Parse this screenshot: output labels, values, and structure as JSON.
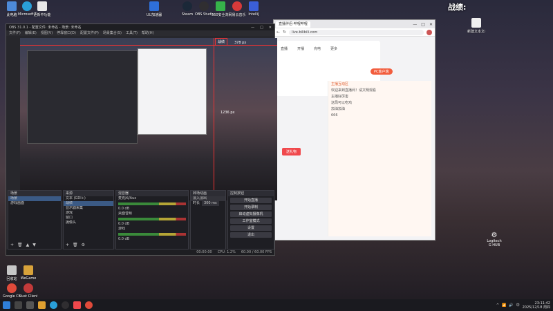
{
  "desktop": {
    "top_icons": [
      {
        "label": "此电脑"
      },
      {
        "label": "Microsoft Edge"
      },
      {
        "label": "更新中功能"
      },
      {
        "label": "UU加速器"
      },
      {
        "label": "Steam"
      },
      {
        "label": "OBS Studio"
      },
      {
        "label": "360安全浏览器"
      },
      {
        "label": "网易云音乐"
      },
      {
        "label": "IntelliJ"
      }
    ],
    "left_icons": [
      {
        "label": "回收站"
      },
      {
        "label": "Google Chrome"
      },
      {
        "label": "WeGame"
      },
      {
        "label": "Rust Client"
      }
    ],
    "right_icon_label": "新建文本文档",
    "corner_text": "战绩:",
    "logitech_label": "Logitech G HUB"
  },
  "browser": {
    "tab_title": "直播伴侣-哔哩哔哩",
    "url": "live.bilibili.com",
    "pc_badge": "PC客户端",
    "nav_items": [
      "直播",
      "开播",
      "充电",
      "更多"
    ],
    "chat_header": "主播互动区",
    "chat_messages": [
      "欢迎来到直播间！请文明观看",
      "主播好厉害",
      "这局可以吃鸡",
      "加油加油",
      "666"
    ],
    "gift_button": "送礼物"
  },
  "obs": {
    "title": "OBS 31.0.1 - 配置文件: 未命名 - 场景: 未命名",
    "menu": [
      "文件(F)",
      "编辑(E)",
      "视图(V)",
      "停靠窗口(D)",
      "配置文件(P)",
      "场景集合(S)",
      "工具(T)",
      "帮助(H)"
    ],
    "preview_dimension_label": "1236 px",
    "preview_top_label": "战绩",
    "preview_width_label": "378 px",
    "panels": {
      "scenes": {
        "title": "场景",
        "items": [
          "场景",
          "游戏画面"
        ]
      },
      "sources": {
        "title": "来源",
        "items": [
          "文本 (GDI+)",
          "战绩",
          "显示器采集",
          "游戏",
          "窗口",
          "摄像头"
        ]
      },
      "mixer": {
        "title": "混音器",
        "channels": [
          {
            "name": "麦克风/Aux",
            "level": "0.0 dB"
          },
          {
            "name": "桌面音频",
            "level": "0.0 dB"
          },
          {
            "name": "游戏",
            "level": "0.0 dB"
          }
        ]
      },
      "transitions": {
        "title": "转场动画",
        "type": "淡入淡出",
        "duration_label": "时长",
        "duration": "300 ms"
      },
      "controls": {
        "title": "控制按钮",
        "buttons": [
          "开始直播",
          "开始录制",
          "启动虚拟摄像机",
          "工作室模式",
          "设置",
          "退出"
        ]
      }
    },
    "status": {
      "cpu": "CPU: 1.2%",
      "fps": "60.00 / 60.00 FPS",
      "time": "00:00:00"
    }
  },
  "taskbar": {
    "time": "23:11:42",
    "date": "2025/12/18 周四",
    "lang": "中"
  }
}
